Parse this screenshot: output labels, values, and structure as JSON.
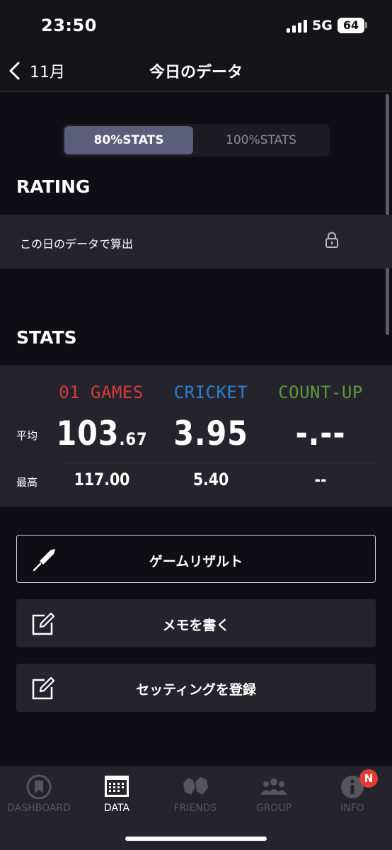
{
  "status_bar": {
    "time": "23:50",
    "network": "5G",
    "battery": "64"
  },
  "nav": {
    "back_label": "11月",
    "title": "今日のデータ"
  },
  "segment": {
    "options": [
      "80%STATS",
      "100%STATS"
    ],
    "selected": "80%STATS"
  },
  "rating": {
    "title": "RATING",
    "row_label": "この日のデータで算出",
    "locked": true
  },
  "stats": {
    "title": "STATS",
    "columns": [
      {
        "name": "01 GAMES",
        "color": "#d63b3b",
        "avg_int": "103",
        "avg_dec": ".67",
        "best": "117.00"
      },
      {
        "name": "CRICKET",
        "color": "#2f7fd6",
        "avg_int": "3.95",
        "avg_dec": "",
        "best": "5.40"
      },
      {
        "name": "COUNT-UP",
        "color": "#5a9a3c",
        "avg_int": "-.--",
        "avg_dec": "",
        "best": "--"
      }
    ],
    "row_labels": {
      "avg": "平均",
      "best": "最高"
    }
  },
  "actions": [
    {
      "label": "ゲームリザルト",
      "icon": "dart-icon",
      "style": "outlined"
    },
    {
      "label": "メモを書く",
      "icon": "edit-icon",
      "style": "filled"
    },
    {
      "label": "セッティングを登録",
      "icon": "edit-icon",
      "style": "filled"
    }
  ],
  "tabs": [
    {
      "label": "DASHBOARD",
      "icon": "dashboard-icon",
      "active": false
    },
    {
      "label": "DATA",
      "icon": "calendar-icon",
      "active": true
    },
    {
      "label": "FRIENDS",
      "icon": "friends-icon",
      "active": false
    },
    {
      "label": "GROUP",
      "icon": "group-icon",
      "active": false
    },
    {
      "label": "INFO",
      "icon": "info-icon",
      "active": false,
      "badge": "N"
    }
  ],
  "colors": {
    "accent": "#5c5c7b",
    "background": "#0f0e14",
    "panel": "#25242c"
  }
}
